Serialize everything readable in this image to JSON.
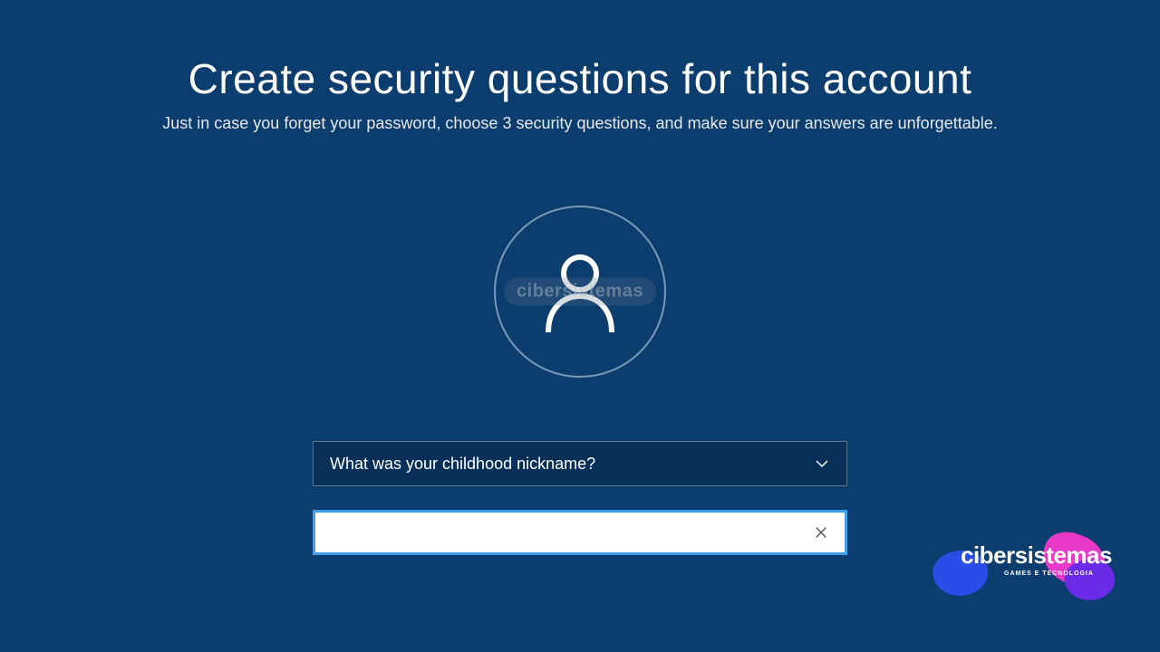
{
  "page": {
    "title": "Create security questions for this account",
    "subtitle": "Just in case you forget your password, choose 3 security questions, and make sure your answers are unforgettable."
  },
  "form": {
    "security_question_selected": "What was your childhood nickname?",
    "answer_value": "",
    "answer_placeholder": ""
  },
  "icons": {
    "avatar": "user-icon",
    "dropdown": "chevron-down-icon",
    "clear": "close-icon"
  },
  "watermark": {
    "center_text": "cibersistemas",
    "brand_text": "cibersistemas",
    "brand_sub": "GAMES E TECNOLOGIA"
  },
  "colors": {
    "background": "#0b3d6f",
    "select_bg": "#072f57",
    "input_border_focus": "#3da0e8",
    "brand_pink": "#e838c8",
    "brand_blue": "#2a4de8",
    "brand_purple": "#6a2be8"
  }
}
